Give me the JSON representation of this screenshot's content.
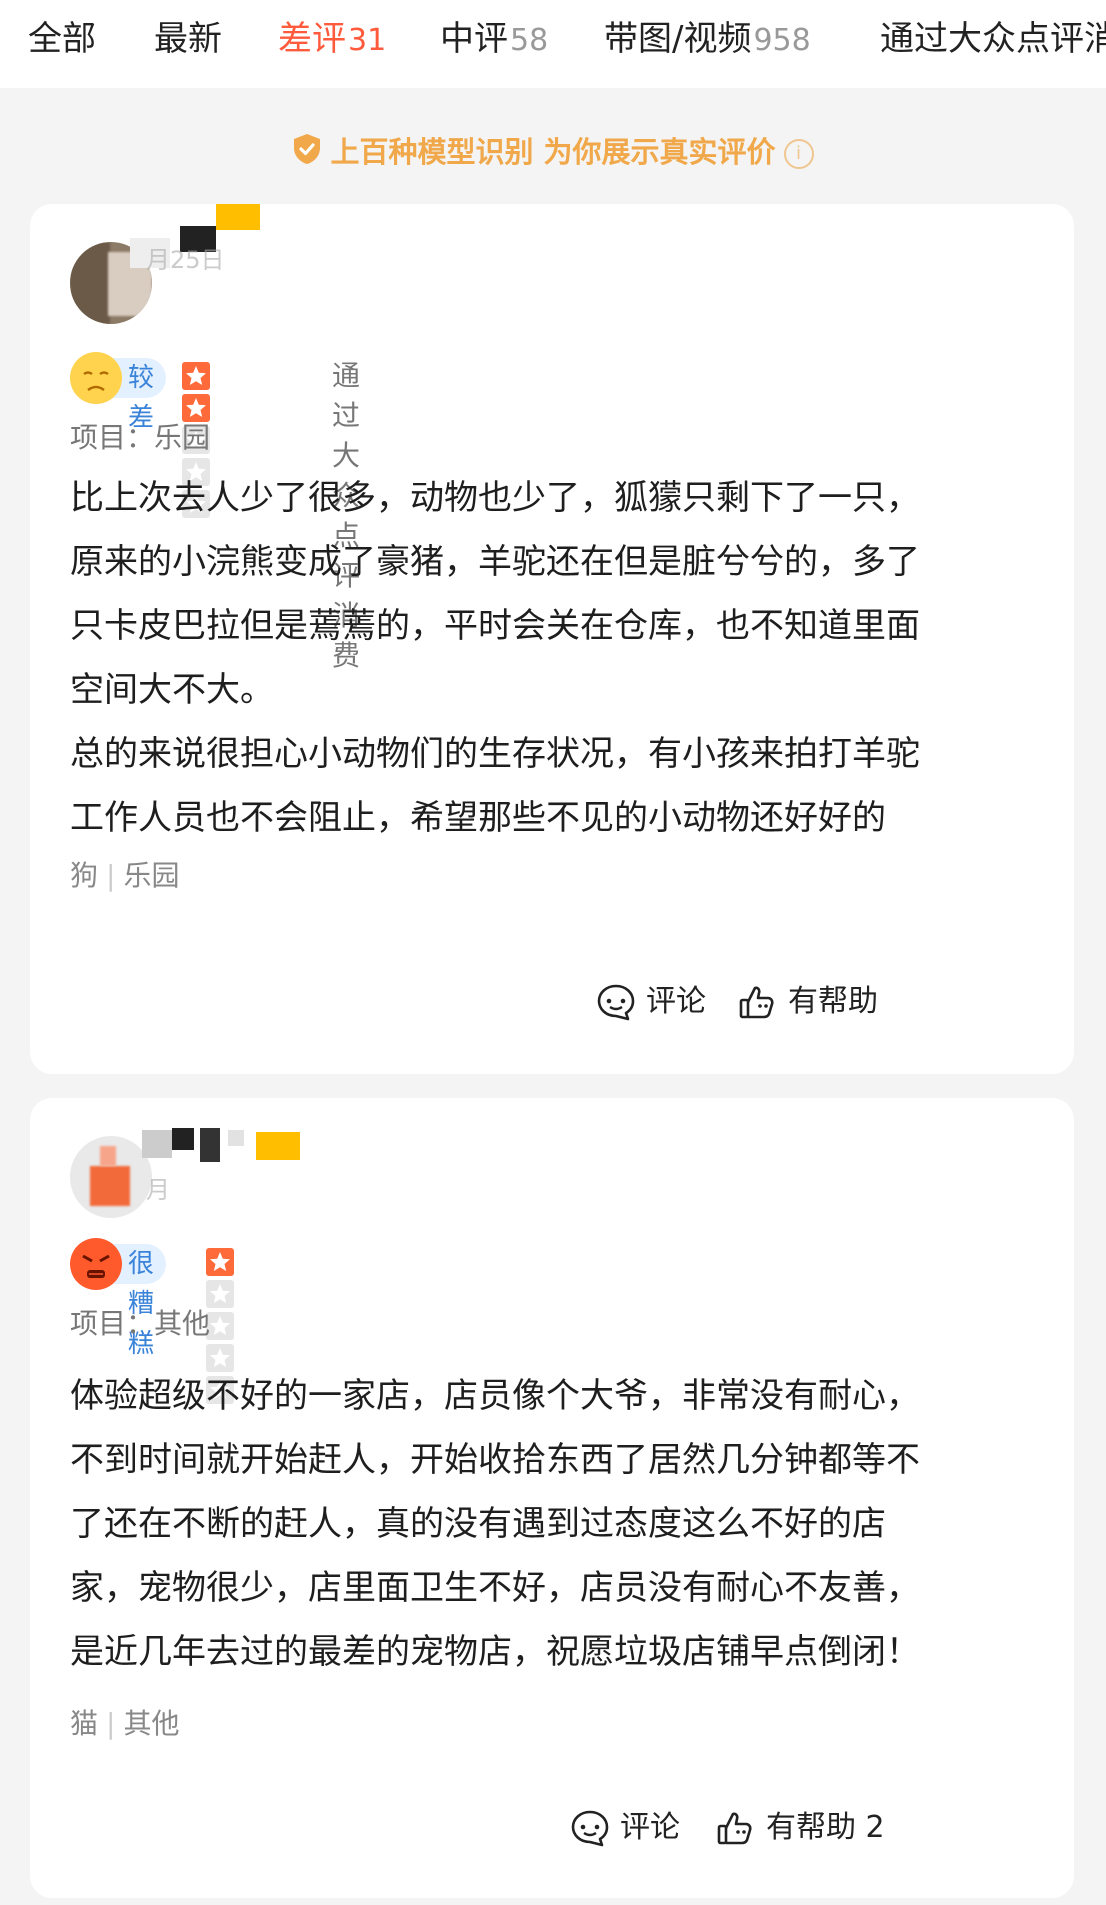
{
  "tabs": [
    {
      "label": "全部",
      "count": ""
    },
    {
      "label": "最新",
      "count": ""
    },
    {
      "label": "差评",
      "count": "31"
    },
    {
      "label": "中评",
      "count": "58"
    },
    {
      "label": "带图/视频",
      "count": "958"
    },
    {
      "label": "通过大众点评消",
      "count": ""
    }
  ],
  "notice": {
    "text": "上百种模型识别 为你展示真实评价",
    "info_icon": "info-icon"
  },
  "reviews": [
    {
      "date": "月25日",
      "level": "较差",
      "stars": 2,
      "consume": "通过大众点评消费",
      "project_label": "项目：",
      "project": "乐园",
      "text": "比上次去人少了很多，动物也少了，狐獴只剩下了一只，\n原来的小浣熊变成了豪猪，羊驼还在但是脏兮兮的，多了\n只卡皮巴拉但是蔫蔫的，平时会关在仓库，也不知道里面\n空间大不大。\n总的来说很担心小动物们的生存状况，有小孩来拍打羊驼\n工作人员也不会阻止，希望那些不见的小动物还好好的",
      "tag1": "狗",
      "tag2": "乐园",
      "comment_label": "评论",
      "helpful_label": "有帮助"
    },
    {
      "date": "月",
      "level": "很糟糕",
      "stars": 1,
      "consume": "",
      "project_label": "项目：",
      "project": "其他",
      "text": "体验超级不好的一家店，店员像个大爷，非常没有耐心，\n不到时间就开始赶人，开始收拾东西了居然几分钟都等不\n了还在不断的赶人，真的没有遇到过态度这么不好的店\n家，宠物很少，店里面卫生不好，店员没有耐心不友善，\n是近几年去过的最差的宠物店，祝愿垃圾店铺早点倒闭！",
      "tag1": "猫",
      "tag2": "其他",
      "comment_label": "评论",
      "helpful_label": "有帮助 2"
    }
  ],
  "colors": {
    "accent": "#ff5a3c",
    "notice": "#f0a84a",
    "level_bg": "#e3f0ff",
    "level_text": "#3a83d8"
  }
}
